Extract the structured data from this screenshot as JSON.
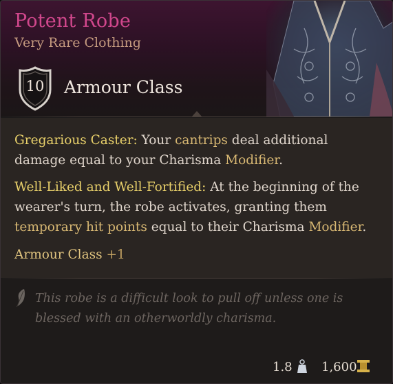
{
  "item": {
    "name": "Potent Robe",
    "rarity": "Very Rare Clothing",
    "name_color": "#d0478c",
    "rarity_color": "#c59a7f",
    "art_icon": "robe-artwork"
  },
  "armour": {
    "value": "10",
    "label": "Armour Class",
    "icon": "shield-icon"
  },
  "properties": [
    {
      "name": "Gregarious Caster:",
      "text_parts": [
        "Your ",
        "cantrips",
        " deal additional damage equal to your Charisma ",
        "Modifier",
        "."
      ]
    },
    {
      "name": "Well-Liked and Well-Fortified:",
      "text_parts": [
        "At the beginning of the wearer's turn, the robe activates, granting them ",
        "temporary hit points",
        " equal to their Charisma ",
        "Modifier",
        "."
      ]
    }
  ],
  "bonus": {
    "label": "Armour Class",
    "value": "+1"
  },
  "flavor": {
    "text": "This robe is a difficult look to pull off unless one is blessed with an otherworldly charisma.",
    "icon": "feather-icon"
  },
  "footer": {
    "weight": "1.8",
    "weight_icon": "weight-icon",
    "value": "1,600",
    "value_icon": "gold-coin-icon"
  }
}
